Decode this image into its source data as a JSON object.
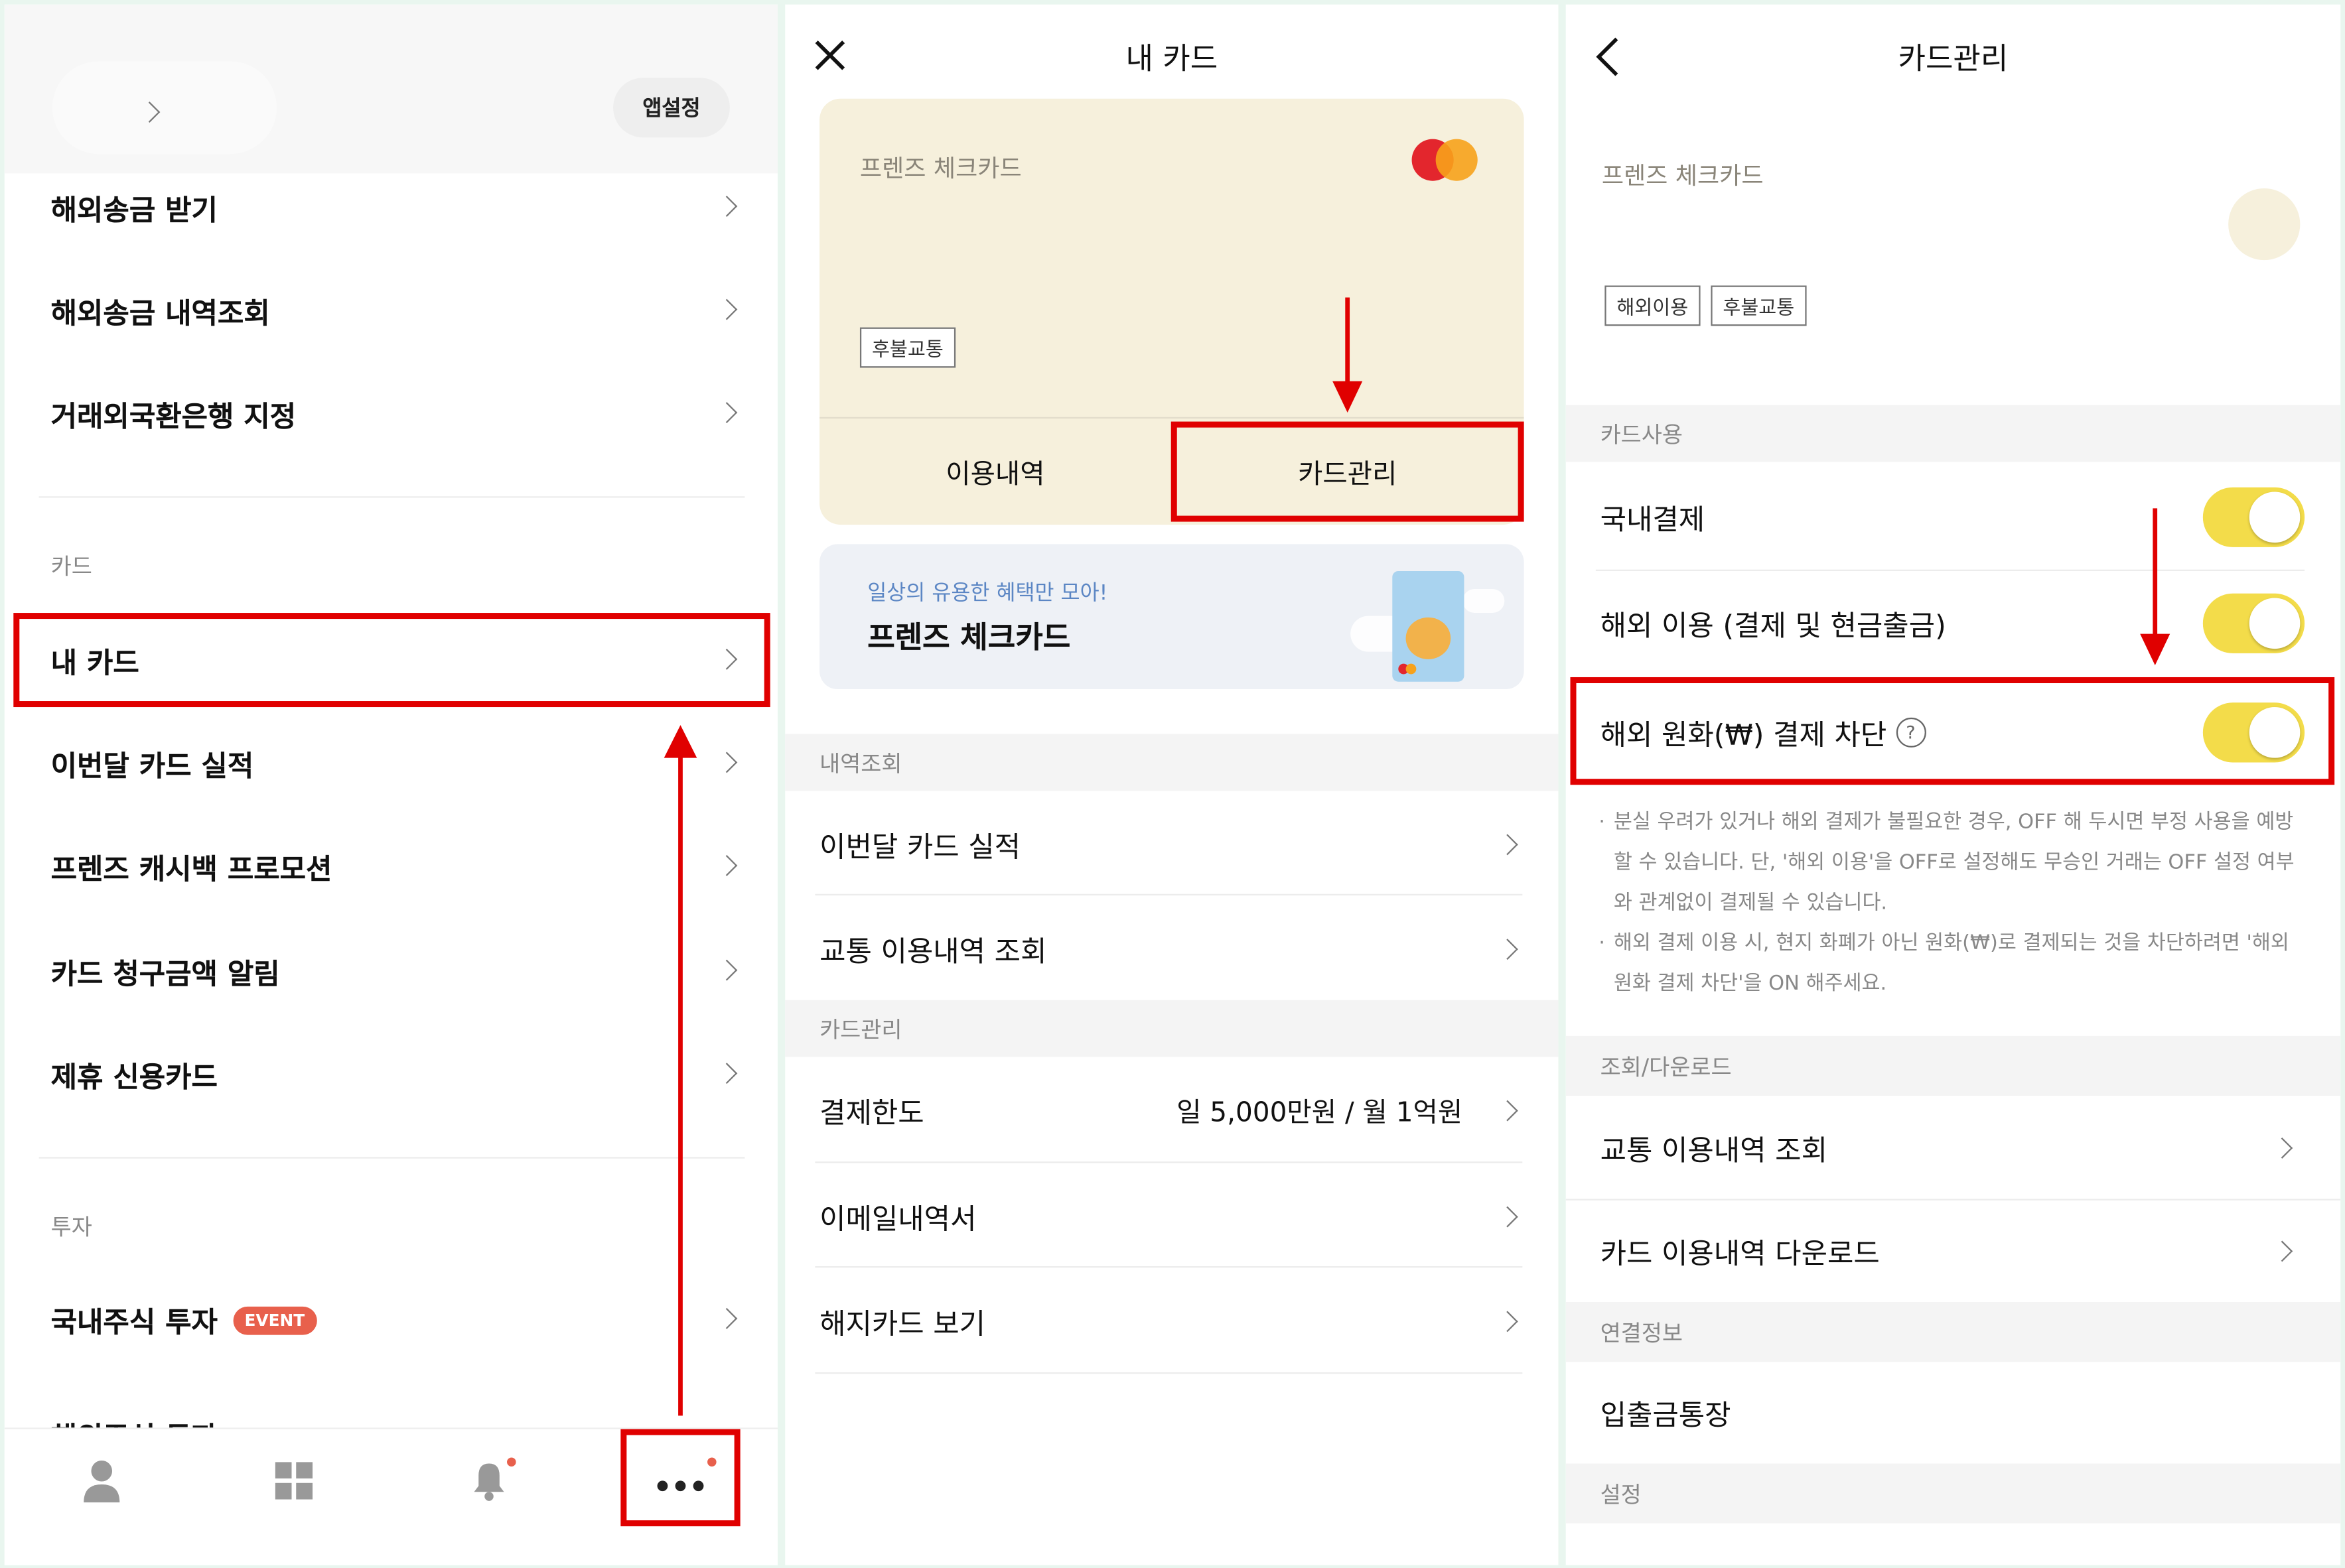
{
  "panel1": {
    "app_settings": "앱설정",
    "menu_top": [
      {
        "label": "해외송금 받기"
      },
      {
        "label": "해외송금 내역조회"
      },
      {
        "label": "거래외국환은행 지정"
      }
    ],
    "section_card": "카드",
    "card_items": [
      {
        "label": "내 카드"
      },
      {
        "label": "이번달 카드 실적"
      },
      {
        "label": "프렌즈 캐시백 프로모션"
      },
      {
        "label": "카드 청구금액 알림"
      },
      {
        "label": "제휴 신용카드"
      }
    ],
    "section_invest": "투자",
    "invest_items": [
      {
        "label": "국내주식 투자",
        "badge": "EVENT"
      },
      {
        "label": "해외주식 투자"
      }
    ],
    "bottom_nav": [
      "person-icon",
      "grid-icon",
      "bell-icon",
      "more-icon"
    ]
  },
  "panel2": {
    "title": "내 카드",
    "card_name": "프렌즈 체크카드",
    "card_tag": "후불교통",
    "btn_history": "이용내역",
    "btn_manage": "카드관리",
    "promo_sub": "일상의 유용한 혜택만 모아!",
    "promo_title": "프렌즈 체크카드",
    "section_history": "내역조회",
    "history_items": [
      {
        "label": "이번달 카드 실적"
      },
      {
        "label": "교통 이용내역 조회"
      }
    ],
    "section_manage": "카드관리",
    "manage_items": [
      {
        "label": "결제한도",
        "value": "일 5,000만원 / 월 1억원"
      },
      {
        "label": "이메일내역서"
      },
      {
        "label": "해지카드 보기"
      }
    ]
  },
  "panel3": {
    "title": "카드관리",
    "card_name": "프렌즈 체크카드",
    "tags": [
      "해외이용",
      "후불교통"
    ],
    "section_usage": "카드사용",
    "toggles": [
      {
        "label": "국내결제",
        "state": "on"
      },
      {
        "label": "해외 이용 (결제 및 현금출금)",
        "state": "on"
      },
      {
        "label": "해외 원화(₩) 결제 차단",
        "state": "on"
      }
    ],
    "notes": [
      "분실 우려가 있거나 해외 결제가 불필요한 경우, OFF 해 두시면 부정 사용을 예방할 수 있습니다. 단, '해외 이용'을 OFF로 설정해도 무승인 거래는 OFF 설정 여부와 관계없이 결제될 수 있습니다.",
      "해외 결제 이용 시, 현지 화폐가 아닌 원화(₩)로 결제되는 것을 차단하려면 '해외 원화 결제 차단'을 ON 해주세요."
    ],
    "section_download": "조회/다운로드",
    "download_items": [
      {
        "label": "교통 이용내역 조회"
      },
      {
        "label": "카드 이용내역 다운로드"
      }
    ],
    "section_link": "연결정보",
    "link_item": "입출금통장",
    "section_settings": "설정"
  },
  "colors": {
    "highlight": "#e00000",
    "toggle_on": "#f3dc4a",
    "card_bg": "#f6f0dc",
    "badge": "#e8604c"
  }
}
